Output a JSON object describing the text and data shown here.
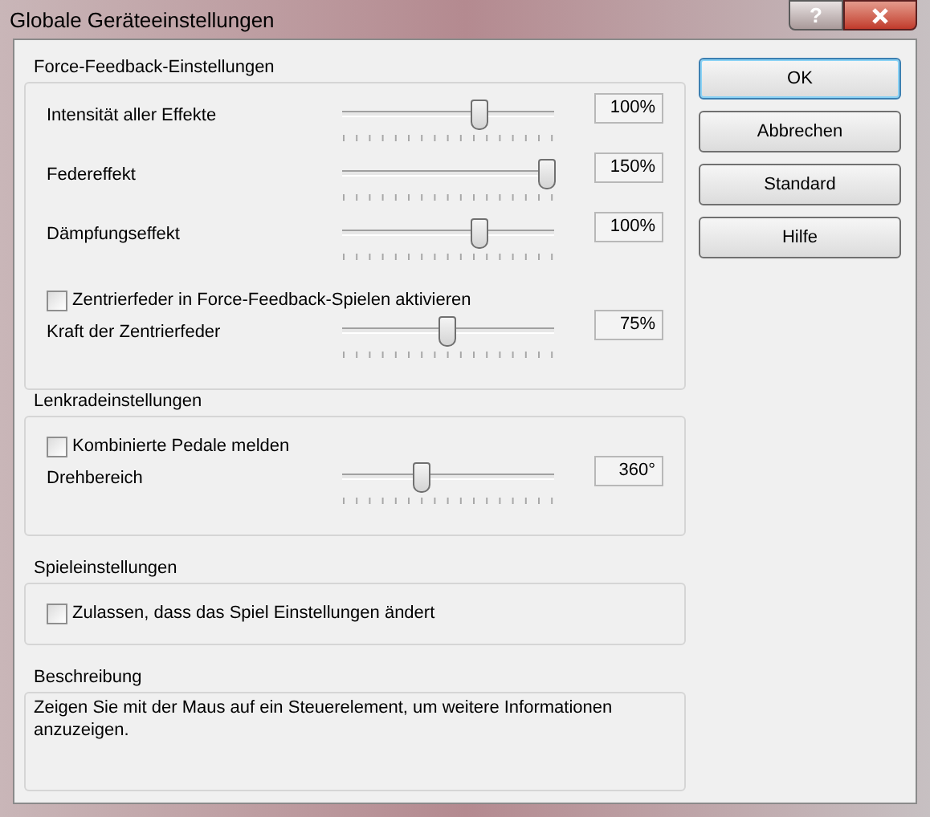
{
  "window": {
    "title": "Globale Geräteeinstellungen",
    "help_button": "?"
  },
  "force_feedback": {
    "title": "Force-Feedback-Einstellungen",
    "items": [
      {
        "kind": "slider",
        "label": "Intensität aller Effekte",
        "level": 0.65,
        "reading": "100%"
      },
      {
        "kind": "slider",
        "label": "Federeffekt",
        "level": 0.97,
        "reading": "150%"
      },
      {
        "kind": "slider",
        "label": "Dämpfungseffekt",
        "level": 0.65,
        "reading": "100%"
      },
      {
        "kind": "checkbox",
        "label": "Zentrierfeder in Force-Feedback-Spielen aktivieren",
        "checked": false
      },
      {
        "kind": "slider",
        "label": "Kraft der Zentrierfeder",
        "level": 0.5,
        "reading": "75%"
      }
    ]
  },
  "wheel": {
    "title": "Lenkradeinstellungen",
    "items": [
      {
        "kind": "checkbox",
        "label": "Kombinierte Pedale melden",
        "checked": false
      },
      {
        "kind": "slider",
        "label": "Drehbereich",
        "level": 0.38,
        "reading": "360°"
      }
    ]
  },
  "games": {
    "title": "Spieleinstellungen",
    "items": [
      {
        "kind": "checkbox",
        "label": "Zulassen, dass das Spiel Einstellungen ändert",
        "checked": false
      }
    ]
  },
  "description": {
    "title": "Beschreibung",
    "text": "Zeigen Sie mit der Maus auf ein Steuerelement, um weitere Informationen anzuzeigen."
  },
  "buttons": [
    {
      "label": "OK",
      "default": true
    },
    {
      "label": "Abbrechen",
      "default": false
    },
    {
      "label": "Standard",
      "default": false
    },
    {
      "label": "Hilfe",
      "default": false
    }
  ]
}
